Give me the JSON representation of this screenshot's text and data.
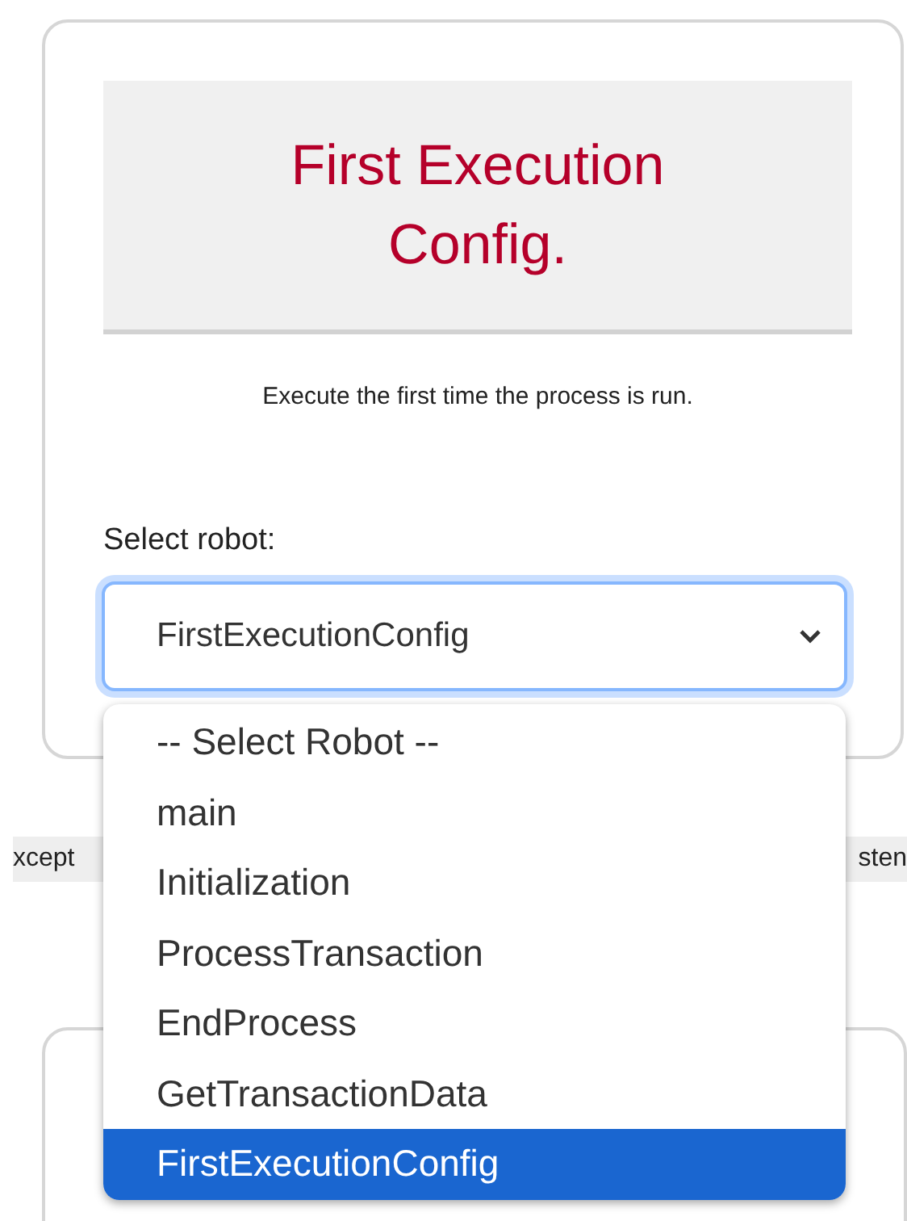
{
  "card": {
    "title": "First Execution Config.",
    "description": "Execute the first time the process is run.",
    "field_label": "Select robot:",
    "select": {
      "value": "FirstExecutionConfig",
      "expanded": true,
      "options": [
        {
          "label": "-- Select Robot --",
          "selected": false
        },
        {
          "label": "main",
          "selected": false
        },
        {
          "label": "Initialization",
          "selected": false
        },
        {
          "label": "ProcessTransaction",
          "selected": false
        },
        {
          "label": "EndProcess",
          "selected": false
        },
        {
          "label": "GetTransactionData",
          "selected": false
        },
        {
          "label": "FirstExecutionConfig",
          "selected": true
        }
      ]
    }
  },
  "background_row": {
    "left_text": "xcept",
    "right_text": "sten"
  }
}
